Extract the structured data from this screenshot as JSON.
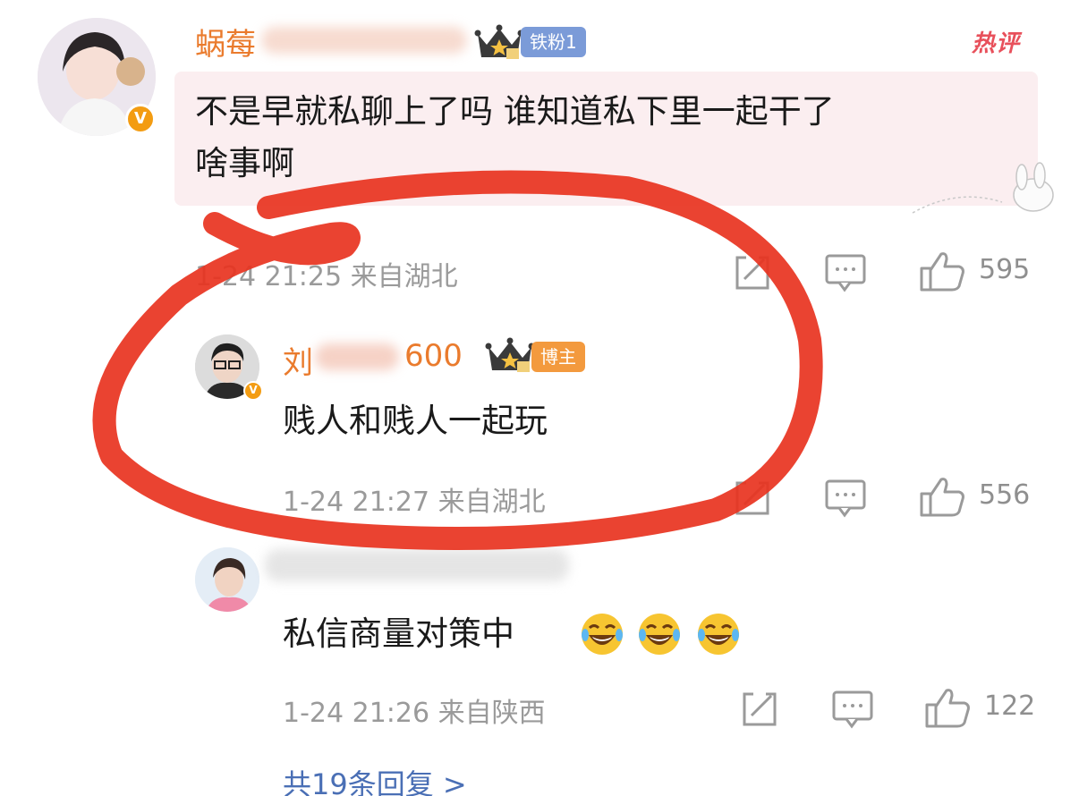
{
  "comments": [
    {
      "username": "蜗莓",
      "fan_badge": "铁粉1",
      "hot_label": "热评",
      "text_line1": "不是早就私聊上了吗 谁知道私下里一起干了",
      "text_line2": "啥事啊",
      "meta": "1-24 21:25 来自湖北",
      "likes": "595"
    },
    {
      "username": "刘",
      "username_suffix": "600",
      "host_badge": "博主",
      "text": "贱人和贱人一起玩",
      "meta": "1-24 21:27 来自湖北",
      "likes": "556"
    },
    {
      "text": "私信商量对策中",
      "meta": "1-24 21:26 来自陕西",
      "likes": "122"
    }
  ],
  "more_replies": "共19条回复 >",
  "icons": [
    "share-icon",
    "comment-icon",
    "like-icon",
    "crown-icon",
    "verified-icon",
    "laughing-emoji-icon"
  ],
  "colors": {
    "username": "#ea7b2d",
    "fan_badge": "#7b9bd8",
    "host_badge": "#f39a3e",
    "hot_label": "#e8505b",
    "more_link": "#4a6fb5",
    "highlight_stroke": "#e8331f"
  }
}
